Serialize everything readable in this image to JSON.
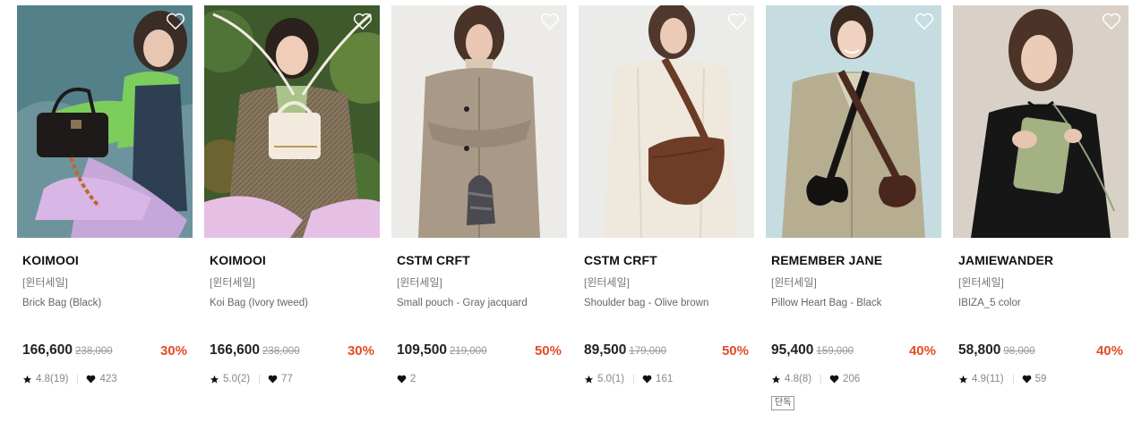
{
  "colors": {
    "discount": "#e44c27",
    "brand_text": "#111111",
    "muted": "#777777"
  },
  "icons": {
    "wishlist": "heart-outline-icon",
    "rating": "star-icon",
    "likes": "heart-icon"
  },
  "products": [
    {
      "brand": "KOIMOOI",
      "tag": "[윈터세일]",
      "name": "Brick Bag (Black)",
      "price": "166,600",
      "original_price": "238,000",
      "discount": "30%",
      "rating": "4.8(19)",
      "likes": "423",
      "badge": null
    },
    {
      "brand": "KOIMOOI",
      "tag": "[윈터세일]",
      "name": "Koi Bag (Ivory tweed)",
      "price": "166,600",
      "original_price": "238,000",
      "discount": "30%",
      "rating": "5.0(2)",
      "likes": "77",
      "badge": null
    },
    {
      "brand": "CSTM CRFT",
      "tag": "[윈터세일]",
      "name": "Small pouch - Gray jacquard",
      "price": "109,500",
      "original_price": "219,000",
      "discount": "50%",
      "rating": null,
      "likes": "2",
      "badge": null
    },
    {
      "brand": "CSTM CRFT",
      "tag": "[윈터세일]",
      "name": "Shoulder bag - Olive brown",
      "price": "89,500",
      "original_price": "179,000",
      "discount": "50%",
      "rating": "5.0(1)",
      "likes": "161",
      "badge": null
    },
    {
      "brand": "REMEMBER JANE",
      "tag": "[윈터세일]",
      "name": "Pillow Heart Bag - Black",
      "price": "95,400",
      "original_price": "159,000",
      "discount": "40%",
      "rating": "4.8(8)",
      "likes": "206",
      "badge": "단독"
    },
    {
      "brand": "JAMIEWANDER",
      "tag": "[윈터세일]",
      "name": "IBIZA_5 color",
      "price": "58,800",
      "original_price": "98,000",
      "discount": "40%",
      "rating": "4.9(11)",
      "likes": "59",
      "badge": null
    }
  ]
}
